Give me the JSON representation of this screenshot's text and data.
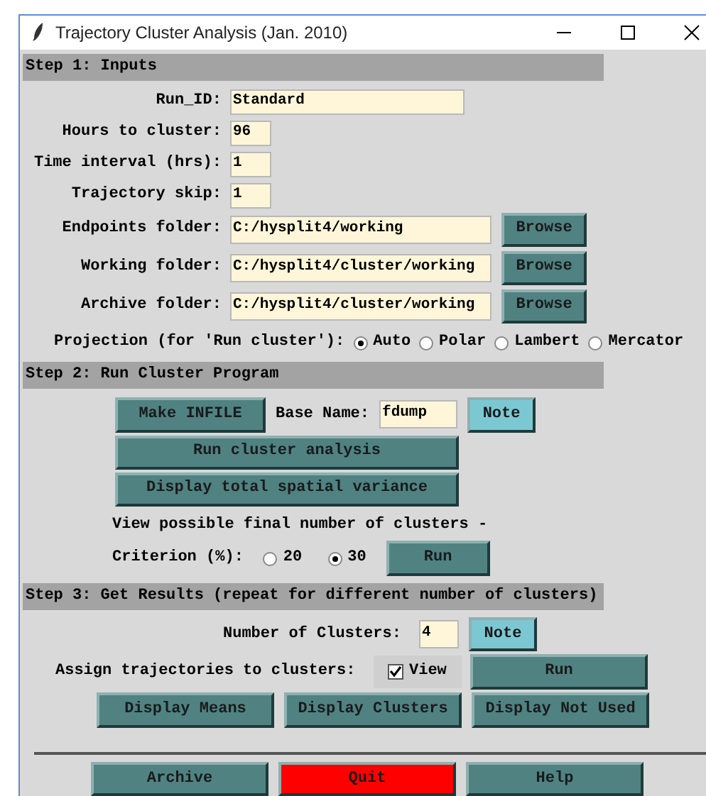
{
  "window": {
    "title": "Trajectory Cluster Analysis (Jan. 2010)"
  },
  "step1": {
    "header": "Step 1: Inputs",
    "short_fields": [
      {
        "label": "Run_ID:",
        "value": "Standard",
        "kind": "wide"
      },
      {
        "label": "Hours to cluster:",
        "value": "96",
        "kind": "narrow"
      },
      {
        "label": "Time interval (hrs):",
        "value": "1",
        "kind": "narrow"
      },
      {
        "label": "Trajectory skip:",
        "value": "1",
        "kind": "narrow"
      }
    ],
    "folders": [
      {
        "label": "Endpoints folder:",
        "value": "C:/hysplit4/working",
        "button": "Browse"
      },
      {
        "label": "Working folder:",
        "value": "C:/hysplit4/cluster/working",
        "button": "Browse"
      },
      {
        "label": "Archive folder:",
        "value": "C:/hysplit4/cluster/working",
        "button": "Browse"
      }
    ],
    "projection": {
      "label": "Projection (for 'Run cluster'):",
      "options": [
        {
          "label": "Auto",
          "selected": true
        },
        {
          "label": "Polar",
          "selected": false
        },
        {
          "label": "Lambert",
          "selected": false
        },
        {
          "label": "Mercator",
          "selected": false
        }
      ]
    }
  },
  "step2": {
    "header": "Step 2: Run Cluster Program",
    "make_infile": "Make INFILE",
    "base_name_label": "Base Name:",
    "base_name": "fdump",
    "note": "Note",
    "run_cluster": "Run cluster analysis",
    "display_variance": "Display total spatial variance",
    "view_text": "View possible final number of clusters -",
    "criterion_label": "Criterion (%):",
    "criterion_options": [
      {
        "label": "20",
        "selected": false
      },
      {
        "label": "30",
        "selected": true
      }
    ],
    "run": "Run"
  },
  "step3": {
    "header": "Step 3: Get Results (repeat for different number of clusters)",
    "number_label": "Number of Clusters:",
    "number": "4",
    "note": "Note",
    "assign_label": "Assign trajectories to clusters:",
    "view": {
      "label": "View",
      "checked": true
    },
    "run": "Run",
    "display_buttons": [
      "Display Means",
      "Display Clusters",
      "Display Not Used"
    ]
  },
  "bottom_buttons": [
    {
      "label": "Archive",
      "kind": "normal"
    },
    {
      "label": "Quit",
      "kind": "danger"
    },
    {
      "label": "Help",
      "kind": "normal"
    }
  ]
}
